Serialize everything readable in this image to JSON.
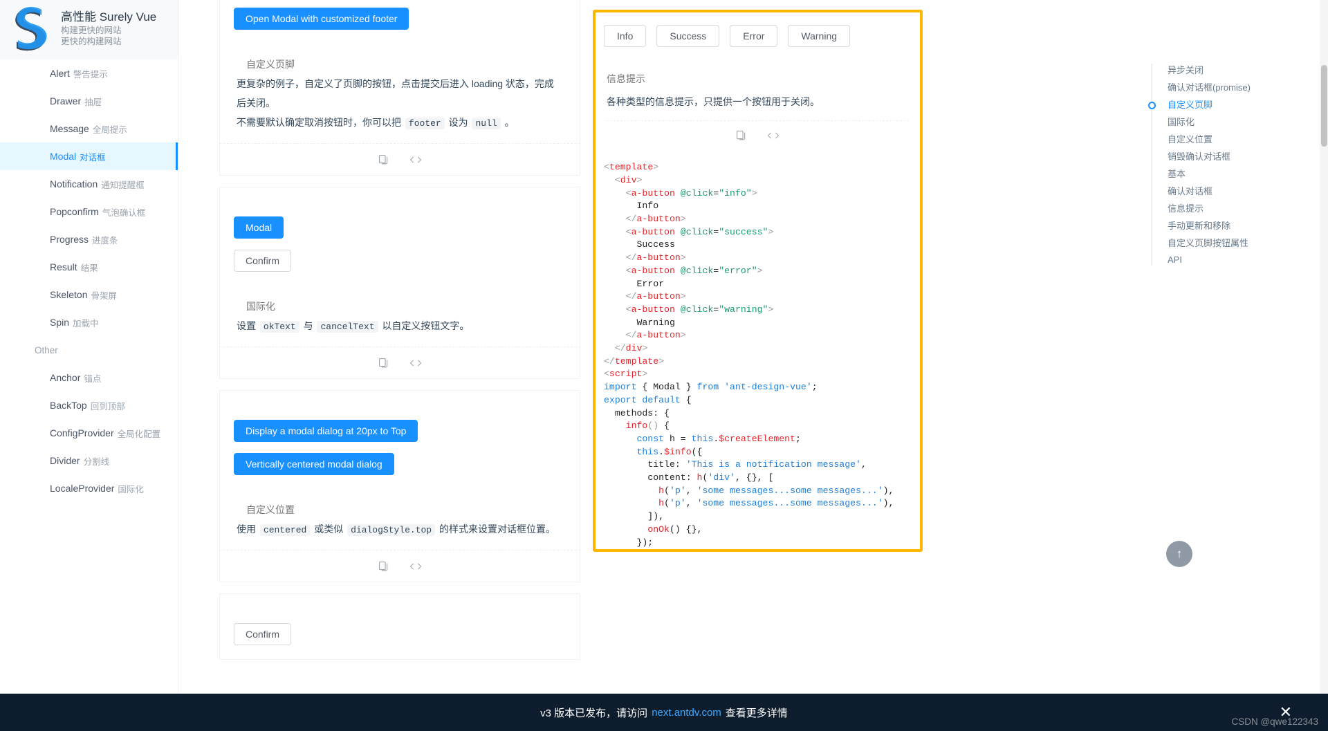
{
  "brand": {
    "title": "高性能 Surely Vue",
    "sub1": "构建更快的网站",
    "sub2": "更快的构建网站",
    "logo_letter": "S"
  },
  "sidebar": {
    "items": [
      {
        "en": "Alert",
        "cn": "警告提示",
        "active": false
      },
      {
        "en": "Drawer",
        "cn": "抽屉",
        "active": false
      },
      {
        "en": "Message",
        "cn": "全局提示",
        "active": false
      },
      {
        "en": "Modal",
        "cn": "对话框",
        "active": true
      },
      {
        "en": "Notification",
        "cn": "通知提醒框",
        "active": false
      },
      {
        "en": "Popconfirm",
        "cn": "气泡确认框",
        "active": false
      },
      {
        "en": "Progress",
        "cn": "进度条",
        "active": false
      },
      {
        "en": "Result",
        "cn": "结果",
        "active": false
      },
      {
        "en": "Skeleton",
        "cn": "骨架屏",
        "active": false
      },
      {
        "en": "Spin",
        "cn": "加载中",
        "active": false
      }
    ],
    "group_label": "Other",
    "other_items": [
      {
        "en": "Anchor",
        "cn": "锚点"
      },
      {
        "en": "BackTop",
        "cn": "回到顶部"
      },
      {
        "en": "ConfigProvider",
        "cn": "全局化配置"
      },
      {
        "en": "Divider",
        "cn": "分割线"
      },
      {
        "en": "LocaleProvider",
        "cn": "国际化"
      }
    ]
  },
  "cards": {
    "card1": {
      "button": "Open Modal with customized footer",
      "title": "自定义页脚",
      "desc_line1": "更复杂的例子，自定义了页脚的按钮，点击提交后进入 loading 状态，完成后关闭。",
      "desc_line2_a": "不需要默认确定取消按钮时，你可以把",
      "desc_code1": "footer",
      "desc_line2_b": "设为",
      "desc_code2": "null",
      "desc_line2_c": "。"
    },
    "card2": {
      "button_primary": "Modal",
      "button_default": "Confirm",
      "title": "国际化",
      "desc_a": "设置",
      "code1": "okText",
      "desc_b": "与",
      "code2": "cancelText",
      "desc_c": "以自定义按钮文字。"
    },
    "card3": {
      "button1": "Display a modal dialog at 20px to Top",
      "button2": "Vertically centered modal dialog",
      "title": "自定义位置",
      "desc_a": "使用",
      "code1": "centered",
      "desc_b": "或类似",
      "code2": "dialogStyle.top",
      "desc_c": "的样式来设置对话框位置。"
    },
    "card4": {
      "button_default": "Confirm"
    }
  },
  "highlight": {
    "buttons": [
      "Info",
      "Success",
      "Error",
      "Warning"
    ],
    "title": "信息提示",
    "desc": "各种类型的信息提示，只提供一个按钮用于关闭。",
    "border_color": "#fcb800",
    "code": "<template>\n  <div>\n    <a-button @click=\"info\">\n      Info\n    </a-button>\n    <a-button @click=\"success\">\n      Success\n    </a-button>\n    <a-button @click=\"error\">\n      Error\n    </a-button>\n    <a-button @click=\"warning\">\n      Warning\n    </a-button>\n  </div>\n</template>\n<script>\nimport { Modal } from 'ant-design-vue';\nexport default {\n  methods: {\n    info() {\n      const h = this.$createElement;\n      this.$info({\n        title: 'This is a notification message',\n        content: h('div', {}, [\n          h('p', 'some messages...some messages...'),\n          h('p', 'some messages...some messages...'),\n        ]),\n        onOk() {},\n      });\n    },"
  },
  "anchor": {
    "items": [
      {
        "label": "异步关闭",
        "active": false
      },
      {
        "label": "确认对话框(promise)",
        "active": false
      },
      {
        "label": "自定义页脚",
        "active": true
      },
      {
        "label": "国际化",
        "active": false
      },
      {
        "label": "自定义位置",
        "active": false
      },
      {
        "label": "销毁确认对话框",
        "active": false
      },
      {
        "label": "基本",
        "active": false
      },
      {
        "label": "确认对话框",
        "active": false
      },
      {
        "label": "信息提示",
        "active": false
      },
      {
        "label": "手动更新和移除",
        "active": false
      },
      {
        "label": "自定义页脚按钮属性",
        "active": false
      },
      {
        "label": "API",
        "active": false
      }
    ]
  },
  "backtop": {
    "glyph": "↑"
  },
  "banner": {
    "text_before": "v3 版本已发布，请访问",
    "link": "next.antdv.com",
    "text_after": "查看更多详情",
    "close_glyph": "✕"
  },
  "watermark": "CSDN @qwe122343"
}
